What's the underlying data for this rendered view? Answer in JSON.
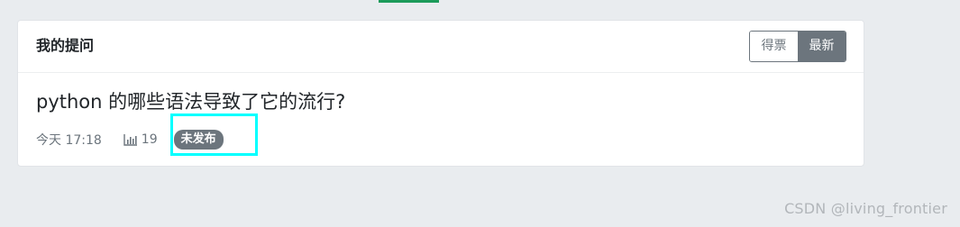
{
  "card": {
    "title": "我的提问",
    "sort_buttons": [
      {
        "label": "得票",
        "active": false
      },
      {
        "label": "最新",
        "active": true
      }
    ]
  },
  "question": {
    "title": "python 的哪些语法导致了它的流行?",
    "time": "今天 17:18",
    "views": "19",
    "status": "未发布"
  },
  "watermark": "CSDN @living_frontier",
  "colors": {
    "accent_green": "#1c9b5a",
    "badge_gray": "#6c757d",
    "highlight_cyan": "#00ffff"
  }
}
